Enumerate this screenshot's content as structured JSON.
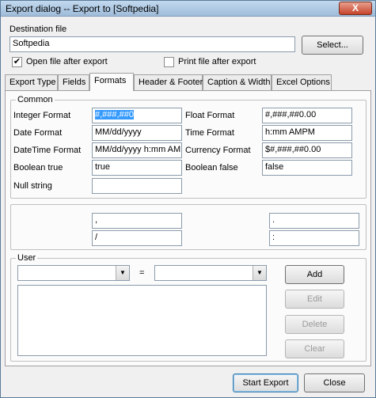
{
  "window": {
    "title": "Export dialog -- Export to [Softpedia]",
    "close_glyph": "X"
  },
  "destination": {
    "label": "Destination file",
    "value": "Softpedia",
    "select_button": "Select...",
    "open_after_export": {
      "label": "Open file after export",
      "checked": true,
      "mark": "✔"
    },
    "print_after_export": {
      "label": "Print file after export",
      "checked": false
    }
  },
  "tabs": [
    "Export Type",
    "Fields",
    "Formats",
    "Header & Footer",
    "Caption & Width",
    "Excel Options"
  ],
  "active_tab": "Formats",
  "common": {
    "title": "Common",
    "integer_format": {
      "label": "Integer Format",
      "value": "#,###,##0"
    },
    "float_format": {
      "label": "Float Format",
      "value": "#,###,##0.00"
    },
    "date_format": {
      "label": "Date Format",
      "value": "MM/dd/yyyy"
    },
    "time_format": {
      "label": "Time Format",
      "value": "h:mm AMPM"
    },
    "datetime_format": {
      "label": "DateTime Format",
      "value": "MM/dd/yyyy h:mm AMI"
    },
    "currency_format": {
      "label": "Currency Format",
      "value": "$#,###,##0.00"
    },
    "boolean_true": {
      "label": "Boolean true",
      "value": "true"
    },
    "boolean_false": {
      "label": "Boolean false",
      "value": "false"
    },
    "null_string": {
      "label": "Null string",
      "value": ""
    }
  },
  "separators": {
    "left_top": ",",
    "left_bottom": "/",
    "right_top": ".",
    "right_bottom": ":"
  },
  "user": {
    "title": "User",
    "equals": "=",
    "add": "Add",
    "edit": "Edit",
    "delete": "Delete",
    "clear": "Clear"
  },
  "footer": {
    "start_export": "Start Export",
    "close": "Close"
  }
}
